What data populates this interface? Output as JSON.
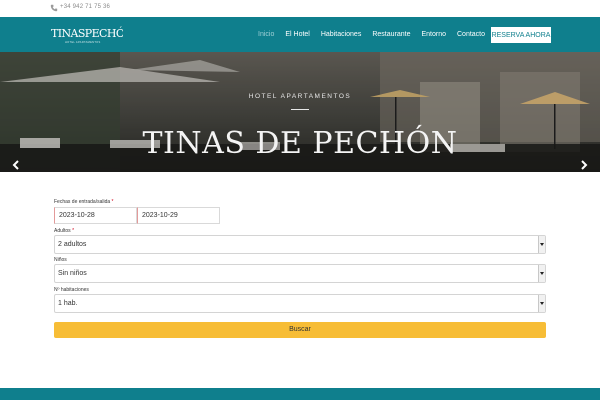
{
  "topbar": {
    "phone": "+34 942 71 75 36",
    "phone_icon": "phone-icon"
  },
  "brand": {
    "logo_text": "TINASPECHÓN",
    "logo_tag": "HOTEL APARTAMENTOS",
    "accent": "#0f7f8d",
    "button_color": "#f7bd36"
  },
  "nav": {
    "items": [
      {
        "label": "Inicio",
        "active": true
      },
      {
        "label": "El Hotel"
      },
      {
        "label": "Habitaciones"
      },
      {
        "label": "Restaurante"
      },
      {
        "label": "Entorno"
      },
      {
        "label": "Contacto"
      }
    ],
    "reserve_label": "RESERVA AHORA"
  },
  "hero": {
    "subtitle": "HOTEL APARTAMENTOS",
    "title": "TINAS DE PECHÓN",
    "prev_icon": "chevron-left-icon",
    "next_icon": "chevron-right-icon"
  },
  "booking": {
    "dates_label": "Fechas de entrada/salida",
    "required_mark": "*",
    "checkin": "2023-10-28",
    "checkout": "2023-10-29",
    "adults_label": "Adultos",
    "adults_value": "2 adultos",
    "children_label": "Niños",
    "children_value": "Sin niños",
    "rooms_label": "Nº habitaciones",
    "rooms_value": "1 hab.",
    "search_label": "Buscar"
  }
}
